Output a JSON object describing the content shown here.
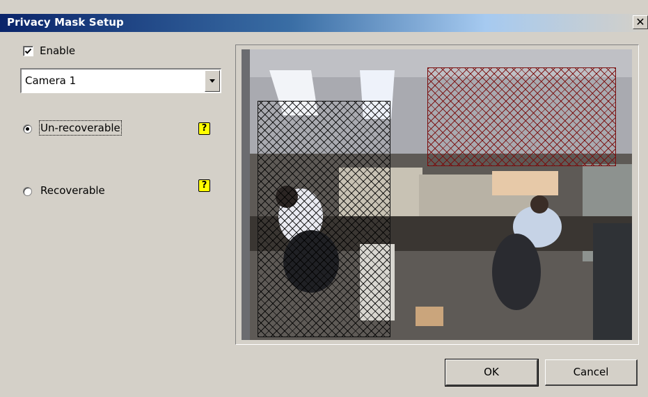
{
  "window": {
    "title": "Privacy Mask Setup",
    "close_glyph": "✕"
  },
  "enable": {
    "label": "Enable",
    "checked": true
  },
  "camera_select": {
    "value": "Camera 1"
  },
  "mask_mode": {
    "options": [
      {
        "label": "Un-recoverable",
        "selected": true,
        "help": "?"
      },
      {
        "label": "Recoverable",
        "selected": false,
        "help": "?"
      }
    ]
  },
  "preview": {
    "masks": [
      {
        "color": "black"
      },
      {
        "color": "#7a0c0c"
      }
    ]
  },
  "buttons": {
    "ok": "OK",
    "cancel": "Cancel"
  }
}
